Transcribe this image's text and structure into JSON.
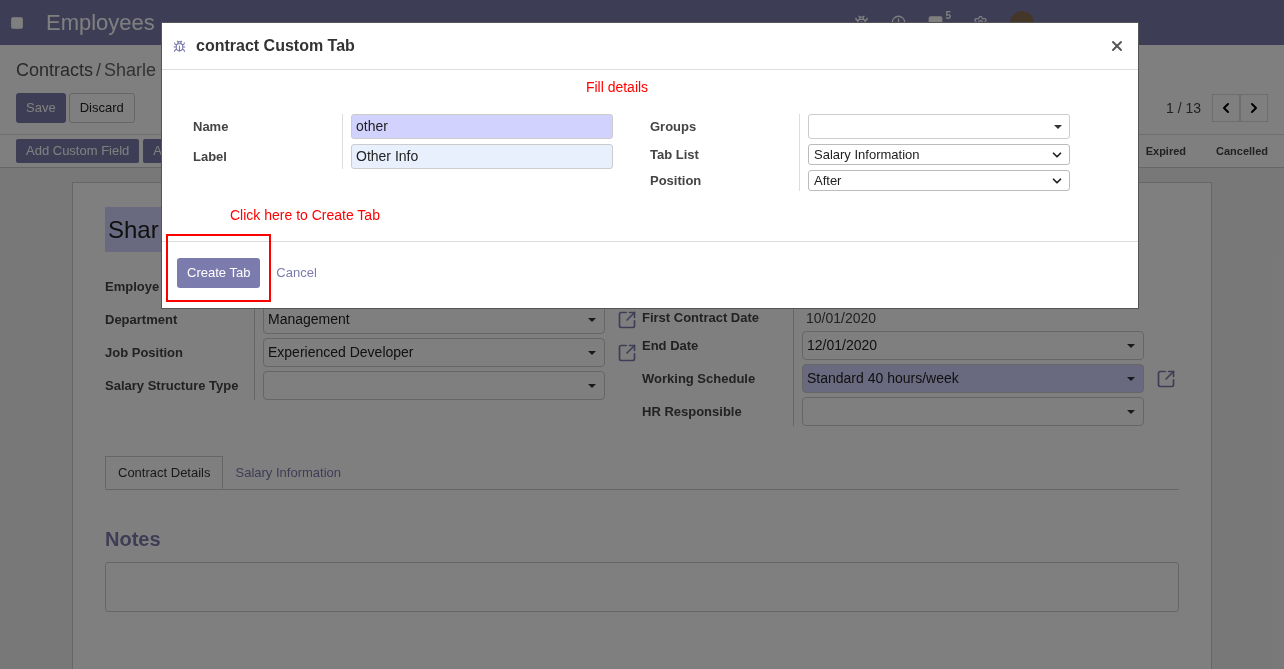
{
  "app_bar": {
    "title": "Employees",
    "messages_count": "5"
  },
  "control_panel": {
    "breadcrumb": [
      "Contracts",
      "Sharle"
    ],
    "separator": "/",
    "buttons": [
      {
        "label": "Save",
        "kind": "primary"
      },
      {
        "label": "Discard",
        "kind": "secondary"
      }
    ],
    "pager": "1 / 13",
    "actions": [
      "Add Custom Field",
      "A"
    ],
    "stages": [
      "Expired",
      "Cancelled"
    ]
  },
  "form": {
    "name": "Shar",
    "left_fields": [
      {
        "label": "Employe",
        "kind": "label_only"
      },
      {
        "label": "Department",
        "kind": "select",
        "value": "Management",
        "required": false,
        "open_link": true
      },
      {
        "label": "Job Position",
        "kind": "select",
        "value": "Experienced Developer",
        "required": false,
        "open_link": true
      },
      {
        "label": "Salary Structure Type",
        "kind": "select",
        "required": false,
        "open_link": false
      }
    ],
    "right_fields": [
      {
        "label": "First Contract Date",
        "kind": "text",
        "value": "10/01/2020"
      },
      {
        "label": "End Date",
        "kind": "select",
        "value": "12/01/2020",
        "required": false,
        "open_link": false
      },
      {
        "label": "Working Schedule",
        "kind": "select",
        "value": "Standard 40 hours/week",
        "required": true,
        "open_link": true
      },
      {
        "label": "HR Responsible",
        "kind": "select",
        "required": false,
        "open_link": false
      }
    ],
    "tabs": [
      {
        "label": "Contract Details",
        "selected": true
      },
      {
        "label": "Salary Information",
        "selected": false
      }
    ],
    "notes_title": "Notes"
  },
  "dialog": {
    "title": "contract Custom Tab",
    "hint_top": "Fill details",
    "left_fields": [
      {
        "label": "Name",
        "kind": "input",
        "value": "other",
        "required": true
      },
      {
        "label": "Label",
        "kind": "input",
        "value": "Other Info",
        "required": false
      }
    ],
    "right_fields": [
      {
        "label": "Groups",
        "kind": "many2many"
      },
      {
        "label": "Tab List",
        "kind": "select",
        "value": "Salary Information"
      },
      {
        "label": "Position",
        "kind": "select",
        "value": "After"
      }
    ],
    "hint_bottom": "Click here to Create Tab",
    "buttons": [
      {
        "label": "Create Tab",
        "kind": "primary",
        "annotated": true
      },
      {
        "label": "Cancel",
        "kind": "link",
        "annotated": false
      }
    ]
  }
}
